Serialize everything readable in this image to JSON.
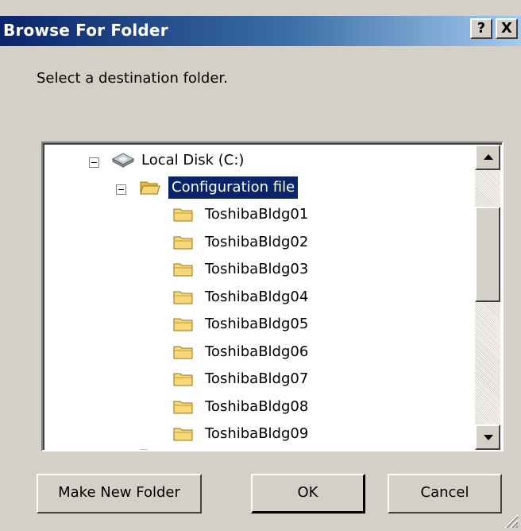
{
  "window": {
    "title": "Browse For Folder",
    "help_label": "?",
    "close_label": "X"
  },
  "instruction": "Select a destination folder.",
  "tree": {
    "drive": {
      "label": "Local Disk (C:)",
      "expanded": true
    },
    "selected_folder": {
      "label": "Configuration file",
      "expanded": true,
      "selected": true
    },
    "children": [
      {
        "label": "ToshibaBldg01"
      },
      {
        "label": "ToshibaBldg02"
      },
      {
        "label": "ToshibaBldg03"
      },
      {
        "label": "ToshibaBldg04"
      },
      {
        "label": "ToshibaBldg05"
      },
      {
        "label": "ToshibaBldg06"
      },
      {
        "label": "ToshibaBldg07"
      },
      {
        "label": "ToshibaBldg08"
      },
      {
        "label": "ToshibaBldg09"
      }
    ]
  },
  "buttons": {
    "make_new_folder": "Make New Folder",
    "ok": "OK",
    "cancel": "Cancel"
  },
  "colors": {
    "selection_bg": "#0a246a",
    "title_gradient_start": "#0a246a",
    "dialog_bg": "#d4d0c8",
    "folder_yellow": "#f6d77a"
  },
  "icons": {
    "drive": "hard-drive-icon",
    "folder_open": "folder-open-icon",
    "folder_closed": "folder-icon",
    "collapse": "collapse-minus-icon",
    "scroll_up": "scroll-up-arrow-icon",
    "scroll_down": "scroll-down-arrow-icon",
    "resize": "resize-grip-icon"
  }
}
